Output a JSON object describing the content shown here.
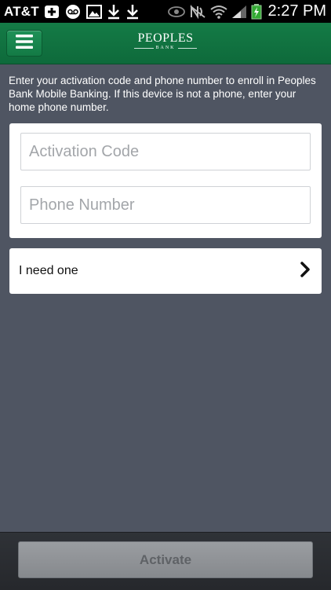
{
  "status_bar": {
    "carrier": "AT&T",
    "time": "2:27 PM",
    "left_icons": [
      "medical-plus-icon",
      "voicemail-icon",
      "image-icon",
      "download-icon",
      "download-icon"
    ],
    "right_icons": [
      "eye-icon",
      "nfc-icon",
      "wifi-icon",
      "signal-icon",
      "battery-charging-icon"
    ]
  },
  "header": {
    "menu_icon": "hamburger-menu-icon",
    "logo_main": "PEOPLES",
    "logo_sub": "BANK",
    "brand_color": "#127443"
  },
  "instructions": "Enter your activation code and phone number to enroll in Peoples Bank Mobile Banking. If this device is not a phone, enter your home phone number.",
  "form": {
    "activation_code": {
      "value": "",
      "placeholder": "Activation Code"
    },
    "phone_number": {
      "value": "",
      "placeholder": "Phone Number"
    }
  },
  "need_one": {
    "label": "I need one",
    "icon": "chevron-right-icon"
  },
  "footer": {
    "activate_label": "Activate"
  }
}
